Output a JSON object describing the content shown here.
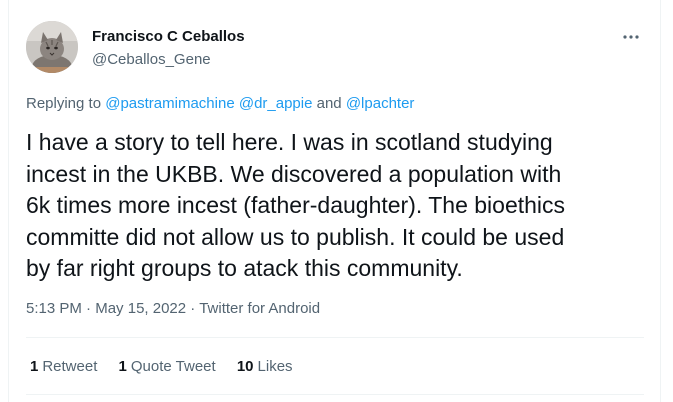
{
  "author": {
    "display_name": "Francisco C Ceballos",
    "handle": "@Ceballos_Gene",
    "avatar_icon": "cat-avatar"
  },
  "reply_context": {
    "prefix": "Replying to",
    "mention_1": "@pastramimachine",
    "mention_2": "@dr_appie",
    "conjunction": "and",
    "mention_3": "@lpachter"
  },
  "tweet": {
    "lines": [
      "I have a story to tell here. I was in scotland studying",
      "incest in the UKBB. We discovered a population with",
      "6k times more incest (father-daughter). The bioethics",
      "committe did not allow us to publish. It could be used",
      "by far right groups to atack this community."
    ]
  },
  "meta": {
    "time": "5:13 PM",
    "separator": "·",
    "date": "May 15, 2022",
    "source": "Twitter for Android"
  },
  "stats": {
    "retweets_count": "1",
    "retweets_label": "Retweet",
    "quotes_count": "1",
    "quotes_label": "Quote Tweet",
    "likes_count": "10",
    "likes_label": "Likes"
  },
  "colors": {
    "text": "#0f1419",
    "secondary": "#536471",
    "link": "#1d9bf0",
    "border": "#eff3f4"
  }
}
